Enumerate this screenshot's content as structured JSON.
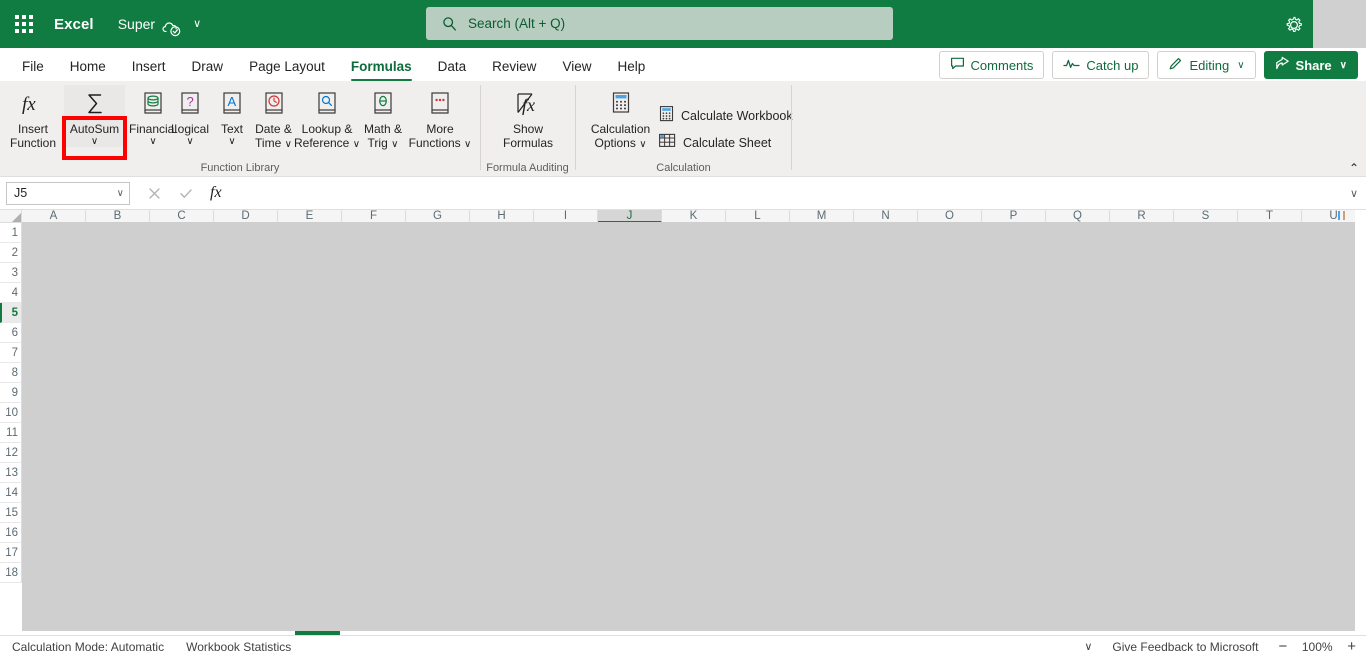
{
  "titlebar": {
    "waffle_name": "app-launcher-icon",
    "brand": "Excel",
    "filename": "Super",
    "saved_icon": "cloud-check-icon",
    "file_chevron": "∨",
    "settings_icon": "gear-icon"
  },
  "search": {
    "icon": "search-icon",
    "placeholder": "Search (Alt + Q)",
    "value": ""
  },
  "tabs": [
    {
      "label": "File",
      "active": false
    },
    {
      "label": "Home",
      "active": false
    },
    {
      "label": "Insert",
      "active": false
    },
    {
      "label": "Draw",
      "active": false
    },
    {
      "label": "Page Layout",
      "active": false
    },
    {
      "label": "Formulas",
      "active": true
    },
    {
      "label": "Data",
      "active": false
    },
    {
      "label": "Review",
      "active": false
    },
    {
      "label": "View",
      "active": false
    },
    {
      "label": "Help",
      "active": false
    }
  ],
  "tab_actions": [
    {
      "label": "Comments",
      "icon": "comment-icon",
      "chevron": "",
      "primary": false
    },
    {
      "label": "Catch up",
      "icon": "catch-up-icon",
      "chevron": "",
      "primary": false
    },
    {
      "label": "Editing",
      "icon": "pencil-icon",
      "chevron": "∨",
      "primary": false
    },
    {
      "label": "Share",
      "icon": "share-icon",
      "chevron": "∨",
      "primary": true
    }
  ],
  "ribbon": {
    "collapse_icon": "⌃",
    "groups": [
      {
        "name": "function-library",
        "label": "Function Library",
        "buttons": [
          {
            "name": "insert-function",
            "label": "Insert\nFunction",
            "icon": "fx-icon",
            "chevron": "",
            "selected": false
          },
          {
            "name": "autosum",
            "label": "AutoSum",
            "icon": "sigma-icon",
            "chevron": "∨",
            "selected": true
          },
          {
            "name": "financial",
            "label": "Financial",
            "icon": "financial-book-icon",
            "chevron": "∨",
            "selected": false
          },
          {
            "name": "logical",
            "label": "Logical",
            "icon": "logical-book-icon",
            "chevron": "∨",
            "selected": false
          },
          {
            "name": "text",
            "label": "Text",
            "icon": "text-book-icon",
            "chevron": "∨",
            "selected": false
          },
          {
            "name": "date-time",
            "label": "Date &\nTime",
            "icon": "clock-book-icon",
            "chevron": "∨",
            "selected": false
          },
          {
            "name": "lookup-reference",
            "label": "Lookup &\nReference",
            "icon": "lookup-book-icon",
            "chevron": "∨",
            "selected": false
          },
          {
            "name": "math-trig",
            "label": "Math &\nTrig",
            "icon": "theta-book-icon",
            "chevron": "∨",
            "selected": false
          },
          {
            "name": "more-functions",
            "label": "More\nFunctions",
            "icon": "more-book-icon",
            "chevron": "∨",
            "selected": false
          }
        ]
      },
      {
        "name": "formula-auditing",
        "label": "Formula Auditing",
        "buttons": [
          {
            "name": "show-formulas",
            "label": "Show\nFormulas",
            "icon": "show-formulas-icon",
            "chevron": "",
            "selected": false
          }
        ]
      },
      {
        "name": "calculation",
        "label": "Calculation",
        "buttons": [
          {
            "name": "calculation-options",
            "label": "Calculation\nOptions",
            "icon": "calculator-icon",
            "chevron": "∨",
            "selected": false
          }
        ],
        "small_buttons": [
          {
            "name": "calculate-workbook",
            "label": "Calculate Workbook",
            "icon": "calculate-workbook-icon"
          },
          {
            "name": "calculate-sheet",
            "label": "Calculate Sheet",
            "icon": "calculate-sheet-icon"
          }
        ]
      }
    ]
  },
  "highlight": {
    "target": "autosum",
    "color": "#ff0000"
  },
  "formula_bar": {
    "namebox_value": "J5",
    "namebox_chevron": "∨",
    "cancel_icon": "cancel-x-icon",
    "enter_icon": "check-icon",
    "fx_label": "fx",
    "formula_value": "",
    "formula_placeholder": "",
    "expand_chevron": "∨"
  },
  "grid": {
    "columns": [
      "A",
      "B",
      "C",
      "D",
      "E",
      "F",
      "G",
      "H",
      "I",
      "J",
      "K",
      "L",
      "M",
      "N",
      "O",
      "P",
      "Q",
      "R",
      "S",
      "T",
      "U"
    ],
    "highlighted_column": "J",
    "rows": [
      "1",
      "2",
      "3",
      "4",
      "5",
      "6",
      "7",
      "8",
      "9",
      "10",
      "11",
      "12",
      "13",
      "14",
      "15",
      "16",
      "17",
      "18"
    ],
    "highlighted_row": "5",
    "active_cell": "J5"
  },
  "status_bar": {
    "calculation_mode": "Calculation Mode: Automatic",
    "workbook_statistics": "Workbook Statistics",
    "chevron": "∨",
    "feedback": "Give Feedback to Microsoft",
    "zoom_out": "−",
    "zoom_level": "100%",
    "zoom_in": "+"
  },
  "colors": {
    "brand_green": "#107c41",
    "ribbon_bg": "#f0efee",
    "search_bg": "#b7cdc0",
    "overlay_gray": "#cfcfcf",
    "highlight_red": "#ff0000"
  }
}
